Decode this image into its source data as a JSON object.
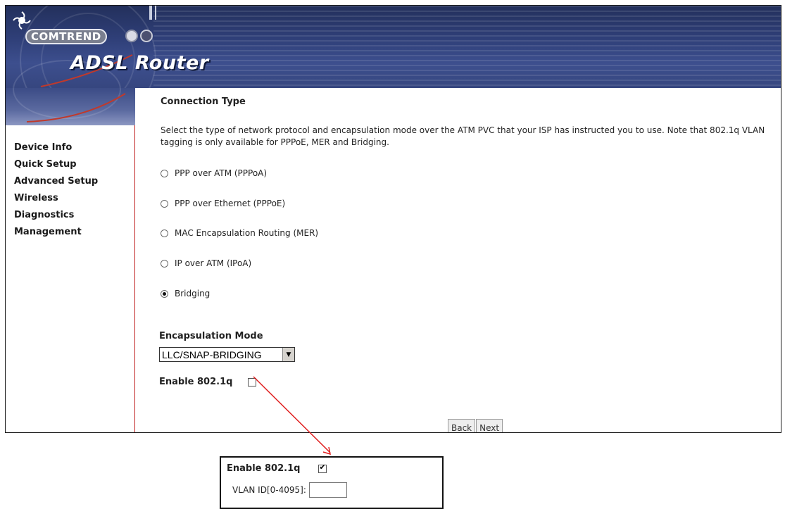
{
  "header": {
    "brand": "COMTREND",
    "product_title": "ADSL Router",
    "logo_icon": "comtrend-swirl-logo"
  },
  "nav": {
    "items": [
      {
        "label": "Device Info"
      },
      {
        "label": "Quick Setup"
      },
      {
        "label": "Advanced Setup"
      },
      {
        "label": "Wireless"
      },
      {
        "label": "Diagnostics"
      },
      {
        "label": "Management"
      }
    ]
  },
  "main": {
    "heading": "Connection Type",
    "description": "Select the type of network protocol and encapsulation mode over the ATM PVC that your ISP has instructed you to use. Note that 802.1q VLAN tagging is only available for PPPoE, MER and Bridging.",
    "protocol_options": [
      {
        "label": "PPP over ATM (PPPoA)",
        "selected": false
      },
      {
        "label": "PPP over Ethernet (PPPoE)",
        "selected": false
      },
      {
        "label": "MAC Encapsulation Routing (MER)",
        "selected": false
      },
      {
        "label": "IP over ATM (IPoA)",
        "selected": false
      },
      {
        "label": "Bridging",
        "selected": true
      }
    ],
    "encapsulation_heading": "Encapsulation Mode",
    "encapsulation_value": "LLC/SNAP-BRIDGING",
    "enable_8021q_label": "Enable 802.1q",
    "enable_8021q_checked": false,
    "back_label": "Back",
    "next_label": "Next"
  },
  "inset": {
    "enable_8021q_label": "Enable 802.1q",
    "enable_8021q_checked": true,
    "vlan_label": "VLAN ID[0-4095]:",
    "vlan_value": ""
  },
  "colors": {
    "banner": "#2f3f78",
    "nav_border": "#c02020",
    "arrow": "#e02020"
  }
}
